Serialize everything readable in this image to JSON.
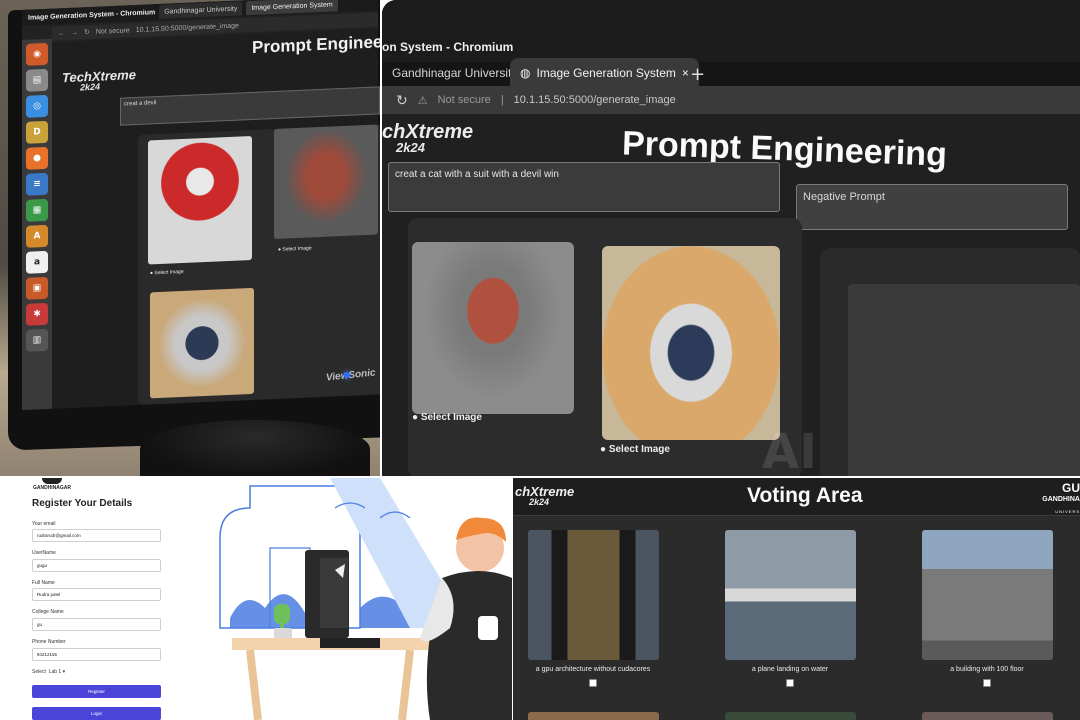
{
  "panel1": {
    "window_title": "Image Generation System - Chromium",
    "tab1": "Gandhinagar University",
    "tab2": "Image Generation System",
    "url_prefix": "Not secure",
    "url": "10.1.15.50:5000/generate_image",
    "logo_line1": "TechXtreme",
    "logo_line2": "2k24",
    "page_title": "Prompt Engineering",
    "prompt_value": "creat a devil",
    "select_label": "Select Image",
    "monitor_brand": "ViewSonic"
  },
  "panel2": {
    "window_title": "on System - Chromium",
    "tab1": "Gandhinagar University",
    "tab2": "Image Generation System",
    "tab_new": "+",
    "url_prefix": "Not secure",
    "url": "10.1.15.50:5000/generate_image",
    "logo_line1": "chXtreme",
    "logo_line2": "2k24",
    "page_title": "Prompt Engineering",
    "prompt_value": "creat a cat with a suit with a devil win",
    "negative_placeholder": "Negative Prompt",
    "select_label": "Select Image",
    "watermark": "AI"
  },
  "registration": {
    "brand": "GANDHINAGAR",
    "title": "Register Your Details",
    "fields": [
      {
        "label": "Your email",
        "value": "rudrarudr@gmail.com"
      },
      {
        "label": "UserName",
        "value": "gugu"
      },
      {
        "label": "Full Name",
        "value": "Rudra patel"
      },
      {
        "label": "College Name",
        "value": "gu"
      },
      {
        "label": "Phone Number",
        "value": "94212155"
      }
    ],
    "select_label": "Select",
    "select_value": "Lab 1 ▾",
    "register_button": "Register",
    "login_button": "Login"
  },
  "voting": {
    "logo_line1": "chXtreme",
    "logo_line2": "2k24",
    "title": "Voting Area",
    "univ_top": "GU",
    "univ_name": "GANDHINA",
    "univ_sub": "UNIVERS",
    "items": [
      {
        "caption": "a gpu architecture without cudacores"
      },
      {
        "caption": "a plane landing on water"
      },
      {
        "caption": "a building with 100 floor"
      }
    ]
  }
}
